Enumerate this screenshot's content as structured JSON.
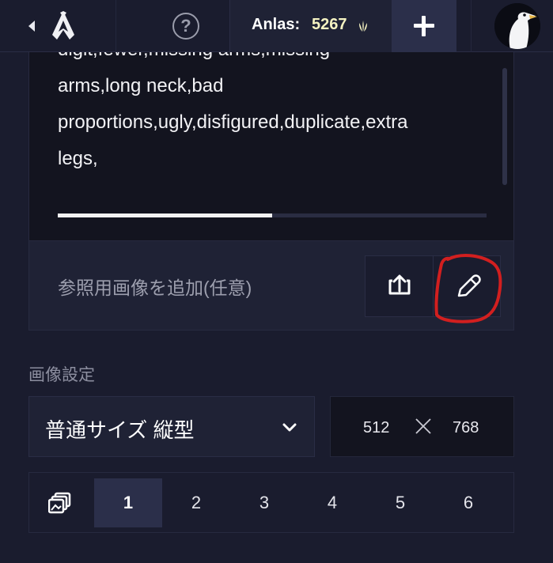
{
  "header": {
    "back_icon": "chevron-left-icon",
    "logo_icon": "novelai-logo-icon",
    "help_icon": "question-circle-icon",
    "help_glyph": "?",
    "anlas": {
      "label": "Anlas:",
      "value": "5267",
      "icon": "anlas-icon"
    },
    "add_icon": "plus-icon",
    "avatar_icon": "penguin-avatar-icon"
  },
  "negative_prompt": {
    "lines": [
      "digit,fewer,missing arms,missing",
      "arms,long neck,bad",
      "proportions,ugly,disfigured,duplicate,extra",
      "legs,"
    ],
    "progress_fraction": 0.5
  },
  "reference": {
    "label": "参照用画像を追加(任意)",
    "upload_icon": "upload-icon",
    "draw_icon": "pencil-icon"
  },
  "image_settings": {
    "title": "画像設定",
    "size_option": "普通サイズ 縦型",
    "width": "512",
    "height": "768",
    "times_icon": "times-icon"
  },
  "image_count": {
    "icon": "copies-icon",
    "options": [
      "1",
      "2",
      "3",
      "4",
      "5",
      "6"
    ],
    "selected": "1"
  },
  "colors": {
    "background": "#1a1c2e",
    "panel": "#1f2235",
    "textarea": "#13141f",
    "anlas_accent": "#f5f3c2",
    "annotation_red": "#d21f1f"
  }
}
